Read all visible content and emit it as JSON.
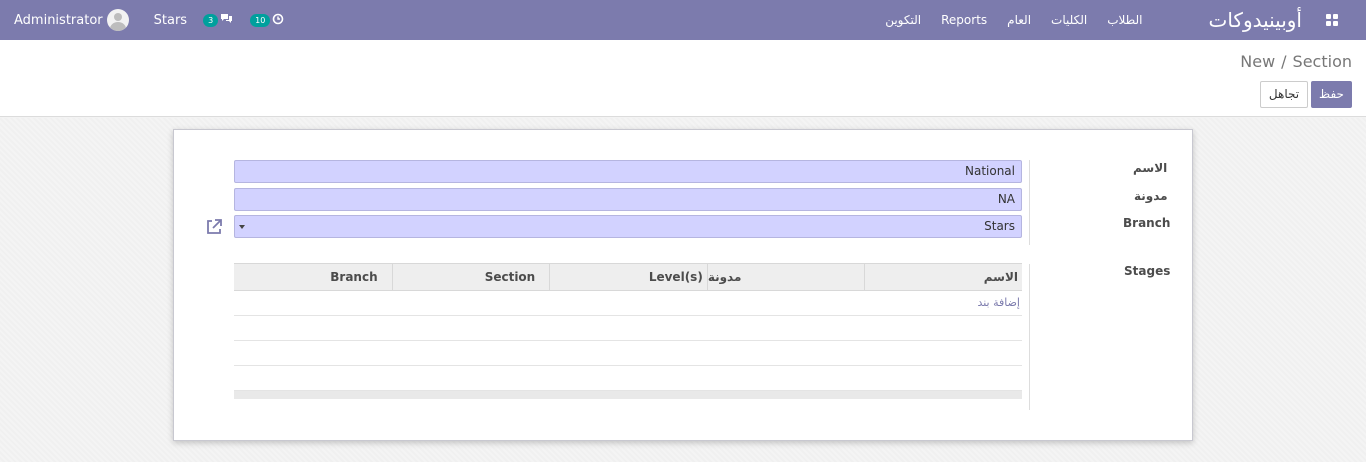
{
  "navbar": {
    "user_name": "Administrator",
    "company": "Stars",
    "messages_count": "3",
    "activities_count": "10",
    "brand": "أوبينيدوكات",
    "menu": [
      "الطلاب",
      "الكليات",
      "العام",
      "Reports",
      "التكوين"
    ],
    "bg_color": "#7c7bad"
  },
  "breadcrumb": {
    "parent": "Section",
    "current": "New"
  },
  "buttons": {
    "save": "حفظ",
    "discard": "تجاهل"
  },
  "form": {
    "name_label": "الاسم",
    "name_value": "National",
    "code_label": "مدونة",
    "code_value": "NA",
    "branch_label": "Branch",
    "branch_value": "Stars",
    "stages_label": "Stages"
  },
  "stages_table": {
    "columns": [
      "الاسم",
      "مدونة",
      "Level(s)",
      "Section",
      "Branch"
    ],
    "add_line": "إضافة بند"
  }
}
